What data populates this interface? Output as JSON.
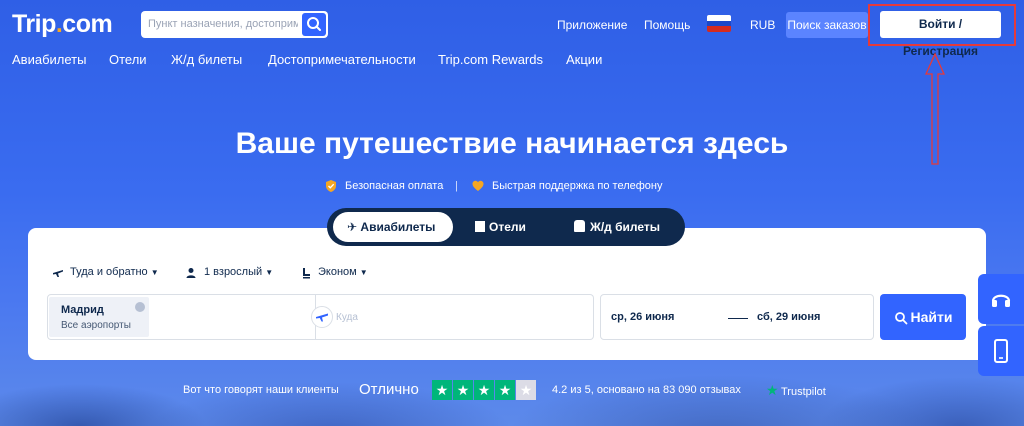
{
  "header": {
    "logo_text": "Trip",
    "logo_dot": ".",
    "logo_suffix": "com",
    "search_placeholder": "Пункт назначения, достопримечательность",
    "app_link": "Приложение",
    "help_link": "Помощь",
    "currency": "RUB",
    "orders_button": "Поиск заказов",
    "signin_button": "Войти / Регистрация"
  },
  "nav": [
    "Авиабилеты",
    "Отели",
    "Ж/д билеты",
    "Достопримечательности",
    "Trip.com Rewards",
    "Акции"
  ],
  "hero": {
    "title": "Ваше путешествие начинается здесь",
    "feature_1": "Безопасная оплата",
    "separator": "|",
    "feature_2": "Быстрая поддержка по телефону"
  },
  "tabs": [
    {
      "label": "Авиабилеты",
      "icon": "plane-icon",
      "active": true
    },
    {
      "label": "Отели",
      "icon": "hotel-icon",
      "active": false
    },
    {
      "label": "Ж/д билеты",
      "icon": "train-icon",
      "active": false
    }
  ],
  "search_form": {
    "trip_type": "Туда и обратно",
    "passengers": "1 взрослый",
    "cabin_class": "Эконом",
    "from_city": "Мадрид",
    "from_sub": "Все аэропорты",
    "to_placeholder": "Куда",
    "depart_date": "ср, 26 июня",
    "return_date": "сб, 29 июня",
    "search_button": "Найти"
  },
  "reviews": {
    "intro": "Вот что говорят наши клиенты",
    "rating_word": "Отлично",
    "stars_filled": 4,
    "stars_total": 5,
    "score_text": "4.2 из 5, основано на 83 090 отзывах",
    "provider": "Trustpilot"
  },
  "colors": {
    "brand_blue": "#3264ff",
    "navy": "#0f294d",
    "highlight_red": "#e53a3a",
    "trustpilot_green": "#00b67a",
    "logo_accent": "#f5a623"
  }
}
